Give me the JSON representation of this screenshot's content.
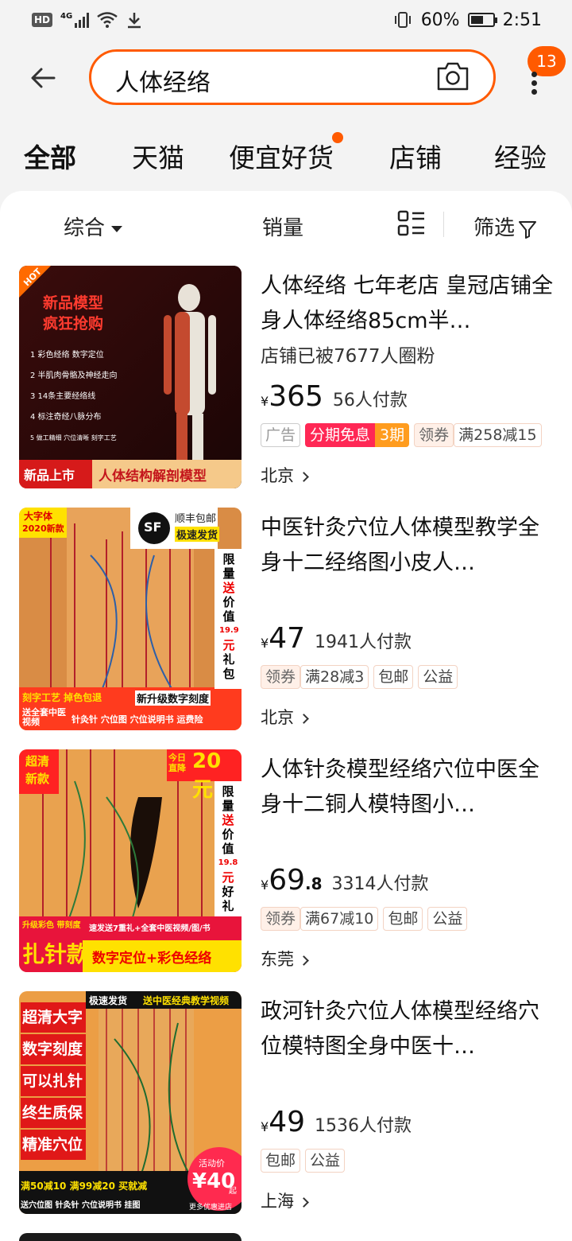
{
  "status_bar": {
    "net": "HD",
    "network_type": "4G",
    "battery": "60%",
    "time": "2:51"
  },
  "search": {
    "query": "人体经络",
    "notification_count": "13"
  },
  "tabs": [
    {
      "label": "全部"
    },
    {
      "label": "天猫"
    },
    {
      "label": "便宜好货"
    },
    {
      "label": "店铺"
    },
    {
      "label": "经验"
    }
  ],
  "sort": {
    "comprehensive": "综合",
    "sales": "销量",
    "filter": "筛选"
  },
  "products": [
    {
      "title": "人体经络 七年老店 皇冠店铺全身人体经络85cm半…",
      "subtitle": "店铺已被7677人圈粉",
      "currency": "¥",
      "price": "365",
      "price_decimal": "",
      "buyers": "56人付款",
      "tags": [
        "广告",
        "分期免息",
        "3期",
        "领券",
        "满258减15"
      ],
      "location": "北京",
      "thumb_texts": [
        "HOT",
        "新品模型",
        "疯狂抢购",
        "1 彩色经络 数字定位",
        "2 半肌肉骨骼及神经走向",
        "3 14条主要经络线",
        "4 标注奇经八脉分布",
        "5 做工精细 穴位清晰 刻字工艺",
        "新品上市",
        "人体结构解剖模型"
      ]
    },
    {
      "title": "中医针灸穴位人体模型教学全身十二经络图小皮人…",
      "subtitle": "",
      "currency": "¥",
      "price": "47",
      "price_decimal": "",
      "buyers": "1941人付款",
      "tags": [
        "领券",
        "满28减3",
        "包邮",
        "公益"
      ],
      "location": "北京",
      "thumb_texts": [
        "大字体",
        "2020新款",
        "SF",
        "顺丰包邮",
        "极速发货",
        "限量",
        "送",
        "价值",
        "19.9",
        "元",
        "礼包",
        "刻字工艺 掉色包退",
        "新升级数字刻度",
        "送全套中医视频",
        "针灸针 穴位图 穴位说明书 运费险"
      ]
    },
    {
      "title": "人体针灸模型经络穴位中医全身十二铜人模特图小…",
      "subtitle": "",
      "currency": "¥",
      "price": "69",
      "price_decimal": ".8",
      "buyers": "3314人付款",
      "tags": [
        "领券",
        "满67减10",
        "包邮",
        "公益"
      ],
      "location": "东莞",
      "thumb_texts": [
        "超清",
        "新款",
        "今日直降",
        "20元",
        "限量",
        "送",
        "价值",
        "19.8",
        "元",
        "好礼",
        "升级彩色 带刻度",
        "扎针款",
        "速发送7重礼+全套中医视频/图/书",
        "数字定位+彩色经络"
      ]
    },
    {
      "title": "政河针灸穴位人体模型经络穴位模特图全身中医十…",
      "subtitle": "",
      "currency": "¥",
      "price": "49",
      "price_decimal": "",
      "buyers": "1536人付款",
      "tags": [
        "包邮",
        "公益"
      ],
      "location": "上海",
      "thumb_texts": [
        "极速发货",
        "送中医经典教学视频",
        "超清大字",
        "数字刻度",
        "可以扎针",
        "终生质保",
        "精准穴位",
        "满50减10 满99减20 买就减",
        "送穴位图 针灸针 穴位说明书 挂图",
        "活动价",
        "¥40",
        "起",
        "更多优惠进店"
      ]
    }
  ],
  "colors": {
    "accent": "#ff5a00",
    "installment": "#ff2855",
    "period": "#ff9c1e"
  }
}
